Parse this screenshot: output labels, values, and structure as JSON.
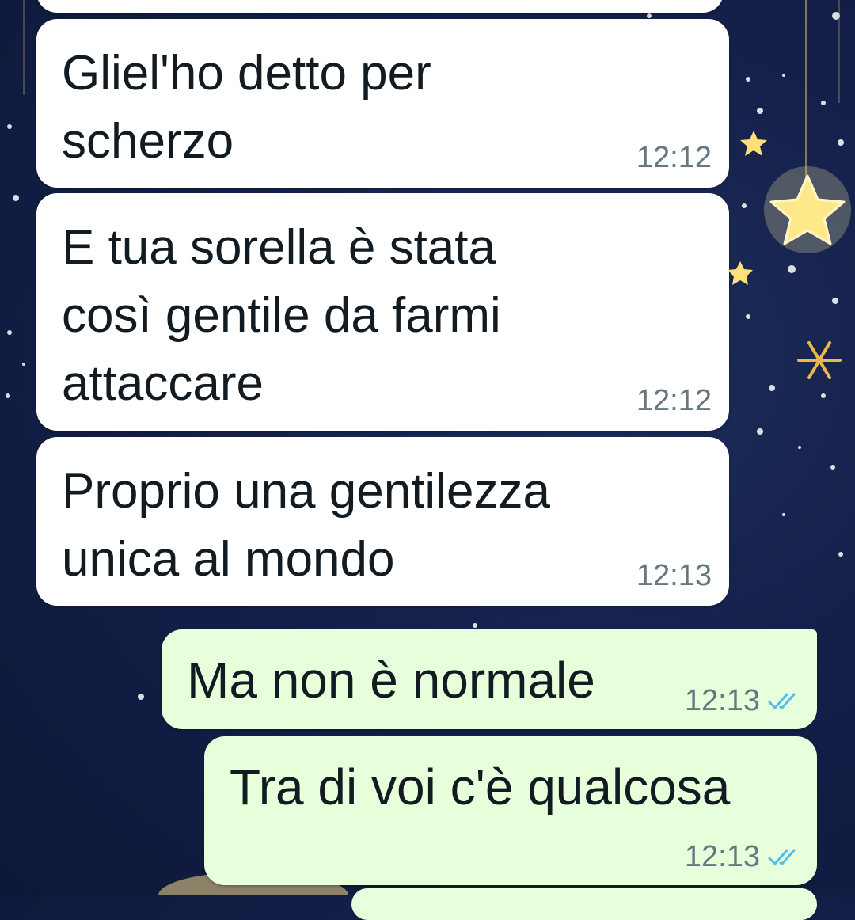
{
  "chat": {
    "messages": [
      {
        "direction": "incoming",
        "text": "",
        "time": ""
      },
      {
        "direction": "incoming",
        "text": "Gliel'ho detto per\nscherzo",
        "time": "12:12"
      },
      {
        "direction": "incoming",
        "text": "E tua sorella è stata\ncosì gentile da farmi\nattaccare",
        "time": "12:12"
      },
      {
        "direction": "incoming",
        "text": "Proprio una gentilezza\nunica al mondo",
        "time": "12:13"
      },
      {
        "direction": "outgoing",
        "text": "Ma non è normale",
        "time": "12:13",
        "status": "read-double-check"
      },
      {
        "direction": "outgoing",
        "text": "Tra di voi c'è qualcosa",
        "time": "12:13",
        "status": "read-double-check"
      }
    ]
  },
  "colors": {
    "incoming_bubble": "#ffffff",
    "outgoing_bubble": "#e7ffdb",
    "read_tick": "#53bdeb",
    "wallpaper": "#14204a"
  },
  "icons": {
    "read_receipt": "double-check-icon",
    "wallpaper": "starry-night-wallpaper"
  }
}
